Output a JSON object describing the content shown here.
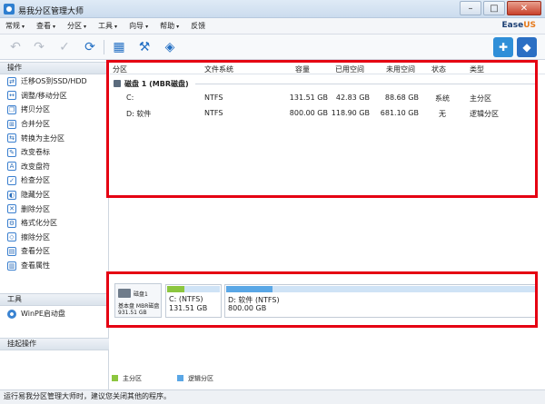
{
  "window": {
    "title": "易我分区管理大师",
    "min_glyph": "–",
    "max_glyph": "□",
    "close_glyph": "✕"
  },
  "menu": [
    "常规",
    "查看",
    "分区",
    "工具",
    "向导",
    "帮助",
    "反馈"
  ],
  "brand": {
    "main": "Ease",
    "accent": "US"
  },
  "sidebar": {
    "ops_header": "操作",
    "ops": [
      "迁移OS到SSD/HDD",
      "调整/移动分区",
      "拷贝分区",
      "合并分区",
      "转换为主分区",
      "改变卷标",
      "改变盘符",
      "检查分区",
      "隐藏分区",
      "删除分区",
      "格式化分区",
      "擦除分区",
      "查看分区",
      "查看属性"
    ],
    "tools_header": "工具",
    "tools_item": "WinPE启动盘",
    "pending_header": "挂起操作"
  },
  "table": {
    "headers": {
      "partition": "分区",
      "fs": "文件系统",
      "capacity": "容量",
      "used": "已用空间",
      "unused": "未用空间",
      "status": "状态",
      "type": "类型"
    },
    "disk_label": "磁盘 1 (MBR磁盘)",
    "rows": [
      {
        "partition": "C:",
        "fs": "NTFS",
        "capacity": "131.51 GB",
        "used": "42.83 GB",
        "unused": "88.68 GB",
        "status": "系统",
        "type": "主分区"
      },
      {
        "partition": "D: 软件",
        "fs": "NTFS",
        "capacity": "800.00 GB",
        "used": "118.90 GB",
        "unused": "681.10 GB",
        "status": "无",
        "type": "逻辑分区"
      }
    ]
  },
  "diskmap": {
    "disk_name": "磁盘1",
    "disk_type": "基本盘 MBR磁盘",
    "disk_size": "931.51 GB",
    "c_label": "C: (NTFS)",
    "c_size": "131.51 GB",
    "c_used_fraction": 0.326,
    "d_label": "D: 软件 (NTFS)",
    "d_size": "800.00 GB",
    "d_used_fraction": 0.149,
    "splitter": "••••••"
  },
  "legend": {
    "primary": "主分区",
    "logical": "逻辑分区"
  },
  "colors": {
    "primary": "#8cc63f",
    "logical": "#5aa7e6",
    "highlight": "#e50012",
    "accent": "#e67a1c"
  },
  "status_text": "运行易我分区管理大师时，建议您关闭其他的程序。"
}
